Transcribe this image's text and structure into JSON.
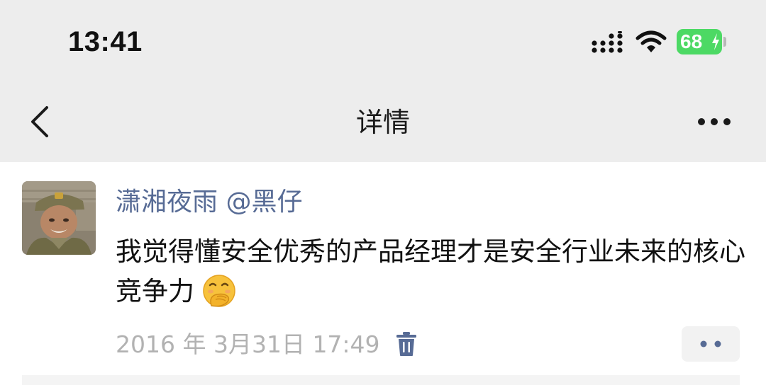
{
  "status_bar": {
    "time": "13:41",
    "battery_level": "68",
    "signal_icon": "signal-bars-icon",
    "wifi_icon": "wifi-icon",
    "battery_icon": "battery-charging-icon"
  },
  "nav": {
    "title": "详情",
    "back_icon": "chevron-left-icon",
    "more_icon": "more-horizontal-icon"
  },
  "post": {
    "author": "潇湘夜雨 @黑仔",
    "text": "我觉得懂安全优秀的产品经理才是安全行业未来的核心竞争力",
    "emoji_icon": "face-with-hand-over-mouth-emoji",
    "timestamp": "2016 年 3月31日 17:49",
    "delete_icon": "trash-icon",
    "action_icon": "two-dots-icon"
  },
  "colors": {
    "nav_background": "#ededed",
    "username": "#576b95",
    "timestamp": "#b2b2b2",
    "battery": "#4cd964"
  }
}
